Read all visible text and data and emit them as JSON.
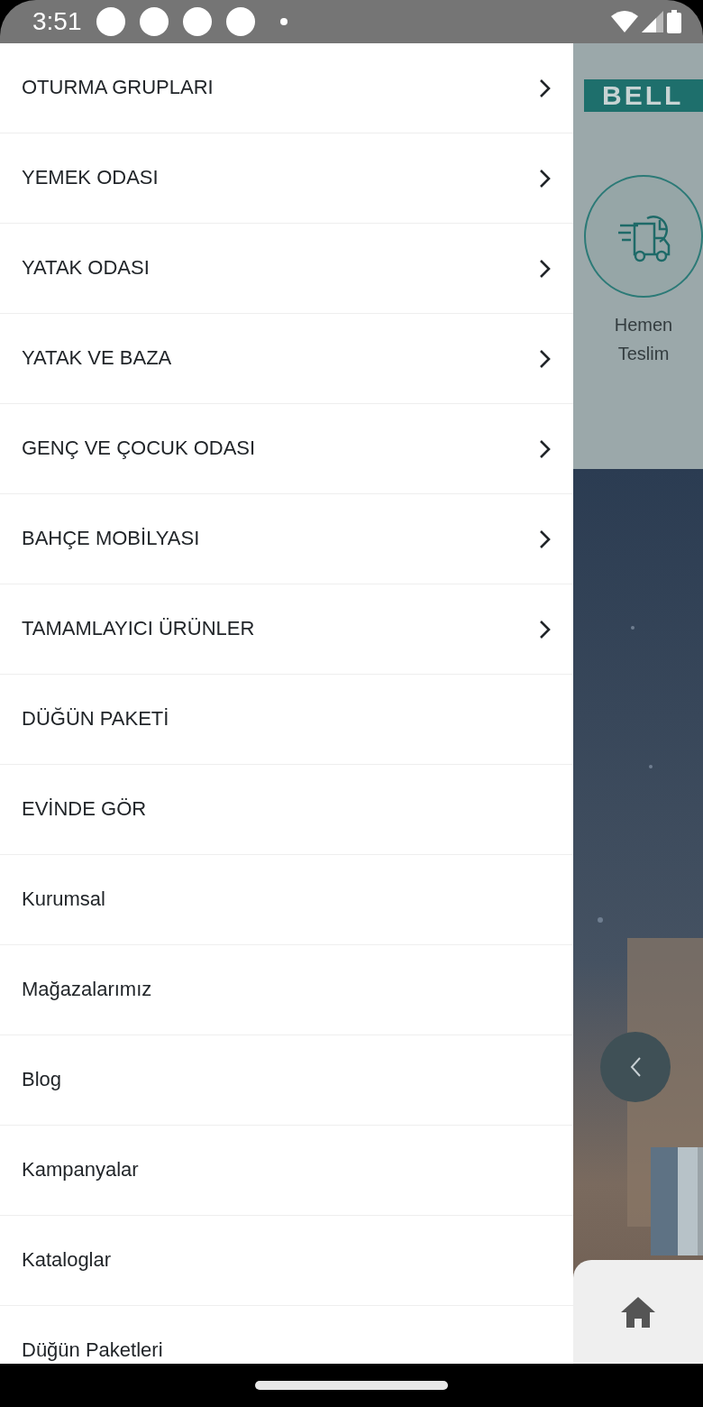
{
  "status_bar": {
    "time": "3:51"
  },
  "drawer": {
    "items": [
      {
        "label": "OTURMA GRUPLARI",
        "expandable": true
      },
      {
        "label": "YEMEK ODASI",
        "expandable": true
      },
      {
        "label": "YATAK ODASI",
        "expandable": true
      },
      {
        "label": "YATAK VE BAZA",
        "expandable": true
      },
      {
        "label": "GENÇ VE ÇOCUK ODASI",
        "expandable": true
      },
      {
        "label": "BAHÇE MOBİLYASI",
        "expandable": true
      },
      {
        "label": "TAMAMLAYICI ÜRÜNLER",
        "expandable": true
      },
      {
        "label": "DÜĞÜN PAKETİ",
        "expandable": false
      },
      {
        "label": "EVİNDE GÖR",
        "expandable": false
      },
      {
        "label": "Kurumsal",
        "expandable": false
      },
      {
        "label": "Mağazalarımız",
        "expandable": false
      },
      {
        "label": "Blog",
        "expandable": false
      },
      {
        "label": "Kampanyalar",
        "expandable": false
      },
      {
        "label": "Kataloglar",
        "expandable": false
      },
      {
        "label": "Düğün Paketleri",
        "expandable": false
      }
    ]
  },
  "background_app": {
    "logo": "BELL",
    "shortcut": {
      "label_lines": [
        "Hemen",
        "Teslim"
      ]
    }
  }
}
